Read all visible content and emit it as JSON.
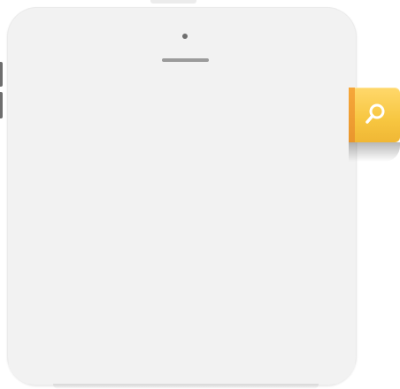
{
  "device": {
    "camera_icon": "camera-dot",
    "speaker_icon": "speaker-slot"
  },
  "search_tab": {
    "icon": "magnifier-icon",
    "accent_color": "#f7c640"
  }
}
